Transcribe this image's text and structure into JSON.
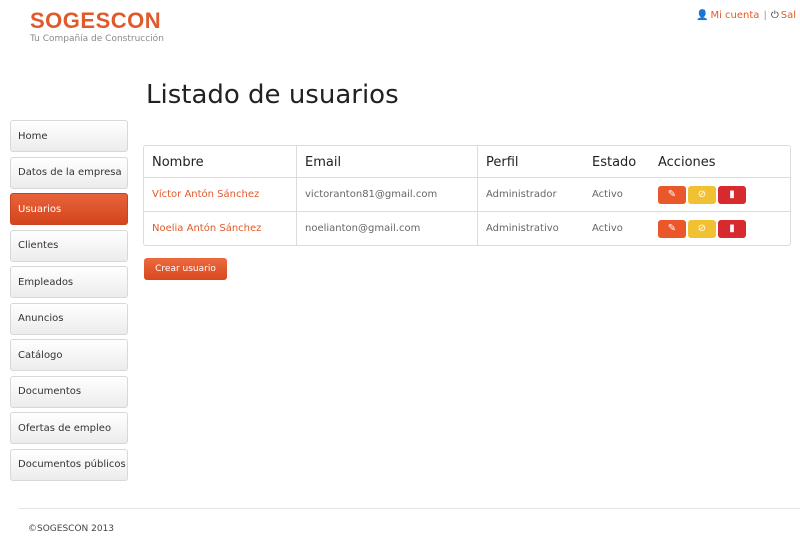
{
  "header": {
    "brand": "SOGESCON",
    "tagline": "Tu Compañía de Construcción",
    "my_account": "Mi cuenta",
    "separator": "|",
    "logout": "Sal"
  },
  "page": {
    "title": "Listado de usuarios"
  },
  "sidebar": {
    "items": [
      {
        "label": "Home"
      },
      {
        "label": "Datos de la empresa"
      },
      {
        "label": "Usuarios",
        "active": true
      },
      {
        "label": "Clientes"
      },
      {
        "label": "Empleados"
      },
      {
        "label": "Anuncios"
      },
      {
        "label": "Catálogo"
      },
      {
        "label": "Documentos"
      },
      {
        "label": "Ofertas de empleo"
      },
      {
        "label": "Documentos públicos"
      }
    ]
  },
  "table": {
    "headers": [
      "Nombre",
      "Email",
      "Perfil",
      "Estado",
      "Acciones"
    ],
    "rows": [
      {
        "name": "Víctor Antón Sánchez",
        "email": "victoranton81@gmail.com",
        "profile": "Administrador",
        "status": "Activo"
      },
      {
        "name": "Noelia Antón Sánchez",
        "email": "noelianton@gmail.com",
        "profile": "Administrativo",
        "status": "Activo"
      }
    ],
    "icons": {
      "edit": "pencil-icon",
      "disable": "ban-icon",
      "delete": "trash-icon"
    }
  },
  "actions": {
    "create_user": "Crear usuario"
  },
  "footer": {
    "text": "©SOGESCON 2013"
  },
  "colors": {
    "accent": "#e05a2b",
    "edit": "#e9572a",
    "disable": "#f1c033",
    "delete": "#d7292e"
  }
}
